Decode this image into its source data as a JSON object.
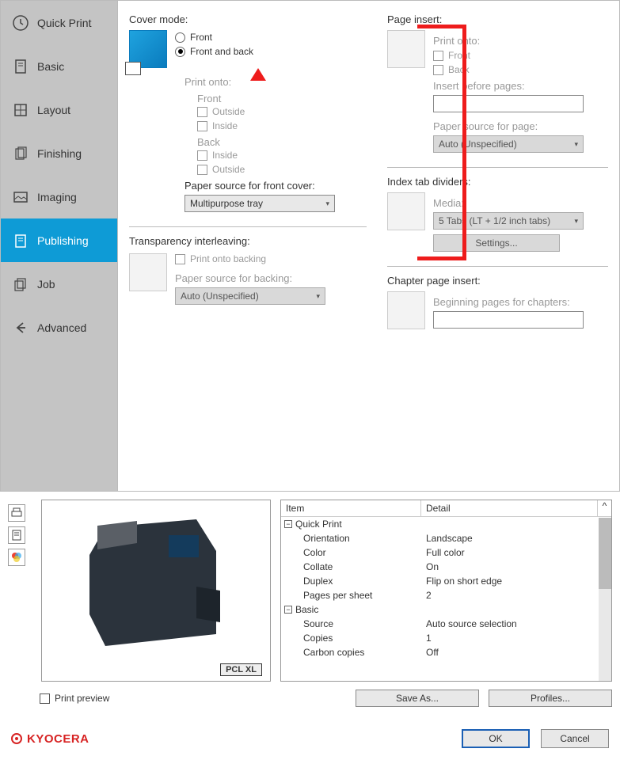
{
  "sidebar": {
    "items": [
      {
        "label": "Quick Print"
      },
      {
        "label": "Basic"
      },
      {
        "label": "Layout"
      },
      {
        "label": "Finishing"
      },
      {
        "label": "Imaging"
      },
      {
        "label": "Publishing"
      },
      {
        "label": "Job"
      },
      {
        "label": "Advanced"
      }
    ]
  },
  "cover": {
    "title": "Cover mode:",
    "front": "Front",
    "frontback": "Front and back",
    "print_onto": "Print onto:",
    "front_sub": "Front",
    "back_sub": "Back",
    "outside": "Outside",
    "inside": "Inside",
    "src_label": "Paper source for front cover:",
    "src_value": "Multipurpose tray"
  },
  "trans": {
    "title": "Transparency interleaving:",
    "print_back": "Print onto backing",
    "src_label": "Paper source for backing:",
    "src_value": "Auto (Unspecified)"
  },
  "page_insert": {
    "title": "Page insert:",
    "print_onto": "Print onto:",
    "front": "Front",
    "back": "Back",
    "before_label": "Insert before pages:",
    "src_label": "Paper source for page:",
    "src_value": "Auto (Unspecified)"
  },
  "index_tab": {
    "title": "Index tab dividers:",
    "media": "Media:",
    "media_value": "5 Tabs (LT + 1/2 inch tabs)",
    "settings": "Settings..."
  },
  "chapter": {
    "title": "Chapter page insert:",
    "label": "Beginning pages for chapters:"
  },
  "detail": {
    "header_item": "Item",
    "header_detail": "Detail",
    "sections": [
      {
        "name": "Quick Print",
        "rows": [
          {
            "k": "Orientation",
            "v": "Landscape"
          },
          {
            "k": "Color",
            "v": "Full color"
          },
          {
            "k": "Collate",
            "v": "On"
          },
          {
            "k": "Duplex",
            "v": "Flip on short edge"
          },
          {
            "k": "Pages per sheet",
            "v": "2"
          }
        ]
      },
      {
        "name": "Basic",
        "rows": [
          {
            "k": "Source",
            "v": "Auto source selection"
          },
          {
            "k": "Copies",
            "v": "1"
          },
          {
            "k": "Carbon copies",
            "v": "Off"
          }
        ]
      }
    ]
  },
  "pcl_badge": "PCL XL",
  "print_preview": "Print preview",
  "saveas": "Save As...",
  "profiles": "Profiles...",
  "brand": "KYOCERA",
  "ok": "OK",
  "cancel": "Cancel"
}
